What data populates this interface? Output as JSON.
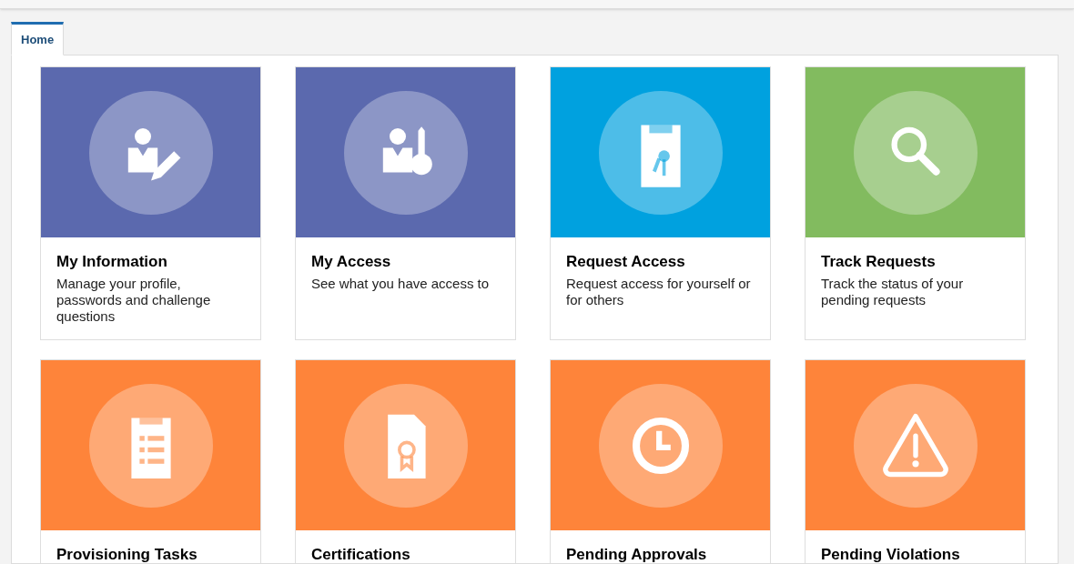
{
  "tabs": [
    {
      "label": "Home",
      "selected": true
    }
  ],
  "tiles": [
    {
      "title": "My Information",
      "description": "Manage your profile, passwords and challenge questions",
      "color": "#5b69ae"
    },
    {
      "title": "My Access",
      "description": "See what you have access to",
      "color": "#5b69ae"
    },
    {
      "title": "Request Access",
      "description": "Request access for yourself or for others",
      "color": "#00a1df"
    },
    {
      "title": "Track Requests",
      "description": "Track the status of your pending requests",
      "color": "#82bb5f"
    },
    {
      "title": "Provisioning Tasks",
      "color": "#fe843a"
    },
    {
      "title": "Certifications",
      "color": "#fe843a"
    },
    {
      "title": "Pending Approvals",
      "color": "#fe843a"
    },
    {
      "title": "Pending Violations",
      "color": "#fe843a"
    }
  ]
}
